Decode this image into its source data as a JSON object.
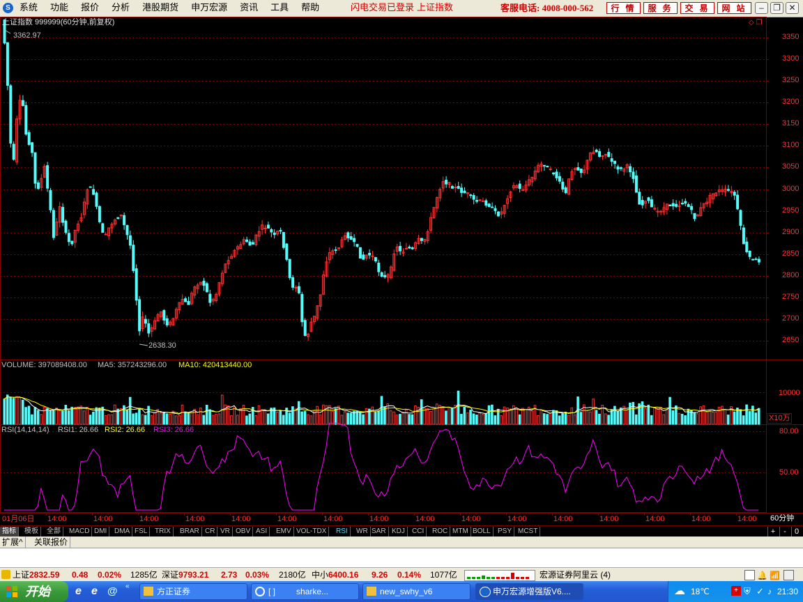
{
  "menubar": {
    "items": [
      "系统",
      "功能",
      "报价",
      "分析",
      "港股期货",
      "申万宏源",
      "资讯",
      "工具",
      "帮助"
    ],
    "notice_login": "闪电交易已登录",
    "notice_index": "上证指数",
    "hotline": "客服电话: 4008-000-562",
    "buttons": [
      "行 情",
      "服 务",
      "交 易",
      "网 站"
    ]
  },
  "chart": {
    "title": "上证指数 999999(60分钟,前复权)",
    "high_label": "3362.97",
    "low_label": "2638.30",
    "price_axis": [
      "3350",
      "3300",
      "3250",
      "3200",
      "3150",
      "3100",
      "3050",
      "3000",
      "2950",
      "2900",
      "2850",
      "2800",
      "2750",
      "2700",
      "2650"
    ],
    "volume_header": {
      "vol": "VOLUME: 397089408.00",
      "ma5": "MA5: 357243296.00",
      "ma10": "MA10: 420413440.00"
    },
    "volume_axis": "10000",
    "volume_unit": "X10万",
    "rsi_header": {
      "name": "RSI(14,14,14)",
      "rsi1": "RSI1: 26.66",
      "rsi2": "RSI2: 26.66",
      "rsi3": "RSI3: 26.66"
    },
    "rsi_axis": [
      "80.00",
      "50.00"
    ],
    "date_first": "01月06日",
    "time_label": "14:00",
    "period": "60分钟",
    "colors": {
      "up": "#ff3232",
      "down": "#54fcfc",
      "grid": "#800000",
      "ma5": "#ffffff",
      "ma10": "#ffff00",
      "rsi": "#ff00ff",
      "axis_text": "#ff3232"
    }
  },
  "tabs": {
    "items": [
      "指标",
      "模板",
      "全部",
      "MACD",
      "DMI",
      "DMA",
      "FSL",
      "TRIX",
      "BRAR",
      "CR",
      "VR",
      "OBV",
      "ASI",
      "EMV",
      "VOL-TDX",
      "RSI",
      "WR",
      "SAR",
      "KDJ",
      "CCI",
      "ROC",
      "MTM",
      "BOLL",
      "PSY",
      "MCST"
    ],
    "selected": "RSI",
    "controls": [
      "+",
      "-",
      "0"
    ]
  },
  "extbar": {
    "items": [
      "扩展^",
      "关联报价"
    ]
  },
  "status": {
    "sh_label": "上证",
    "sh_value": "2832.59",
    "sh_change": "0.48",
    "sh_pct": "0.02%",
    "sh_amount": "1285亿",
    "sz_label": "深证",
    "sz_value": "9793.21",
    "sz_change": "2.73",
    "sz_pct": "0.03%",
    "sz_amount": "2180亿",
    "zx_label": "中小",
    "zx_value": "6400.16",
    "zx_change": "9.26",
    "zx_pct": "0.14%",
    "zx_amount": "1077亿",
    "server": "宏源证券阿里云 (4)"
  },
  "taskbar": {
    "start": "开始",
    "tasks": [
      "方正证券",
      "[ ]",
      "sharke...",
      "new_swhy_v6",
      "申万宏源增强版V6...."
    ],
    "temp": "18℃",
    "clock": "21:30"
  }
}
